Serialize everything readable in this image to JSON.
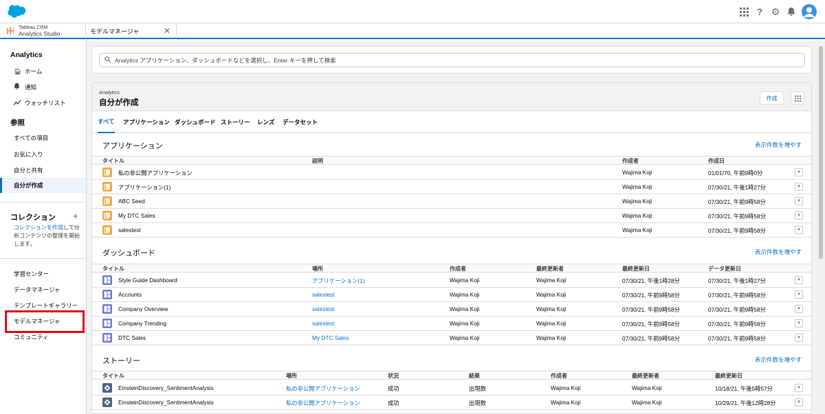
{
  "header": {
    "icons": [
      "app-launcher-icon",
      "help-icon",
      "setup-gear-icon",
      "notification-bell-icon",
      "user-avatar"
    ]
  },
  "tabbar": {
    "brand_line1": "Tableau CRM",
    "brand_line2": "Analytics Studio",
    "open_tab_label": "モデルマネージャ",
    "close_symbol": "✕"
  },
  "sidebar": {
    "analytics_heading": "Analytics",
    "home": "ホーム",
    "notifications": "通知",
    "watchlist": "ウォッチリスト",
    "browse_heading": "参照",
    "all_items": "すべての項目",
    "favorites": "お気に入り",
    "shared_with_me": "自分と共有",
    "created_by_me": "自分が作成",
    "collections_heading": "コレクション",
    "collections_add": "+",
    "collections_link": "コレクションを作成",
    "collections_desc": "して分析コンテンツの整理を開始します。",
    "learning_center": "学習センター",
    "data_manager": "データマネージャ",
    "template_gallery": "テンプレートギャラリー",
    "model_manager": "モデルマネージャ",
    "community": "コミュニティ"
  },
  "search": {
    "placeholder": "Analytics アプリケーション、ダッシュボードなどを選択し、Enter キーを押して検索"
  },
  "main": {
    "breadcrumb": "Analytics",
    "title": "自分が作成",
    "create_button": "作成",
    "tabs": [
      "すべて",
      "アプリケーション",
      "ダッシュボード",
      "ストーリー",
      "レンズ",
      "データセット"
    ],
    "show_more": "表示件数を増やす"
  },
  "apps": {
    "title": "アプリケーション",
    "headers": [
      "タイトル",
      "説明",
      "作成者",
      "作成日"
    ],
    "rows": [
      {
        "title": "私の非公開アプリケーション",
        "desc": "",
        "author": "Wajima Koji",
        "date": "01/01/70, 午前9時0分"
      },
      {
        "title": "アプリケーション(1)",
        "desc": "",
        "author": "Wajima Koji",
        "date": "07/30/21, 午後1時27分"
      },
      {
        "title": "ABC Seed",
        "desc": "",
        "author": "Wajima Koji",
        "date": "07/30/21, 午前9時58分"
      },
      {
        "title": "My DTC Sales",
        "desc": "",
        "author": "Wajima Koji",
        "date": "07/30/21, 午前9時58分"
      },
      {
        "title": "salestest",
        "desc": "",
        "author": "Wajima Koji",
        "date": "07/30/21, 午前9時58分"
      }
    ]
  },
  "dashboards": {
    "title": "ダッシュボード",
    "headers": [
      "タイトル",
      "場所",
      "作成者",
      "最終更新者",
      "最終更新日",
      "データ更新日"
    ],
    "rows": [
      {
        "title": "Style Guide Dashboard",
        "location": "アプリケーション(1)",
        "author": "Wajima Koji",
        "modifier": "Wajima Koji",
        "modified": "07/30/21, 午後1時28分",
        "refreshed": "07/30/21, 午後1時27分"
      },
      {
        "title": "Accounts",
        "location": "salestest",
        "author": "Wajima Koji",
        "modifier": "Wajima Koji",
        "modified": "07/30/21, 午前9時58分",
        "refreshed": "07/30/21, 午前9時58分"
      },
      {
        "title": "Company Overview",
        "location": "salestest",
        "author": "Wajima Koji",
        "modifier": "Wajima Koji",
        "modified": "07/30/21, 午前9時58分",
        "refreshed": "07/30/21, 午前9時58分"
      },
      {
        "title": "Company Trending",
        "location": "salestest",
        "author": "Wajima Koji",
        "modifier": "Wajima Koji",
        "modified": "07/30/21, 午前9時58分",
        "refreshed": "07/30/21, 午前9時58分"
      },
      {
        "title": "DTC Sales",
        "location": "My DTC Sales",
        "author": "Wajima Koji",
        "modifier": "Wajima Koji",
        "modified": "07/30/21, 午前9時58分",
        "refreshed": "07/30/21, 午前9時58分"
      }
    ]
  },
  "stories": {
    "title": "ストーリー",
    "headers": [
      "タイトル",
      "場所",
      "状況",
      "結果",
      "作成者",
      "最終更新者",
      "最終更新日"
    ],
    "rows": [
      {
        "title": "EinsteinDiscovery_SentimentAnalysis",
        "location": "私の非公開アプリケーション",
        "status": "成功",
        "result": "出現数",
        "author": "Wajima Koji",
        "modifier": "Wajima Koji",
        "modified": "10/18/21, 午後5時57分"
      },
      {
        "title": "EinsteinDiscovery_SentimentAnalysis",
        "location": "私の非公開アプリケーション",
        "status": "成功",
        "result": "出現数",
        "author": "Wajima Koji",
        "modifier": "Wajima Koji",
        "modified": "10/29/21, 午後12時28分"
      }
    ]
  },
  "colors": {
    "brand_blue": "#0070d2",
    "highlight_red": "#e5000f",
    "app_icon": "#f9a83c",
    "dashboard_icon": "#6f78d8",
    "story_icon": "#4a6582"
  }
}
